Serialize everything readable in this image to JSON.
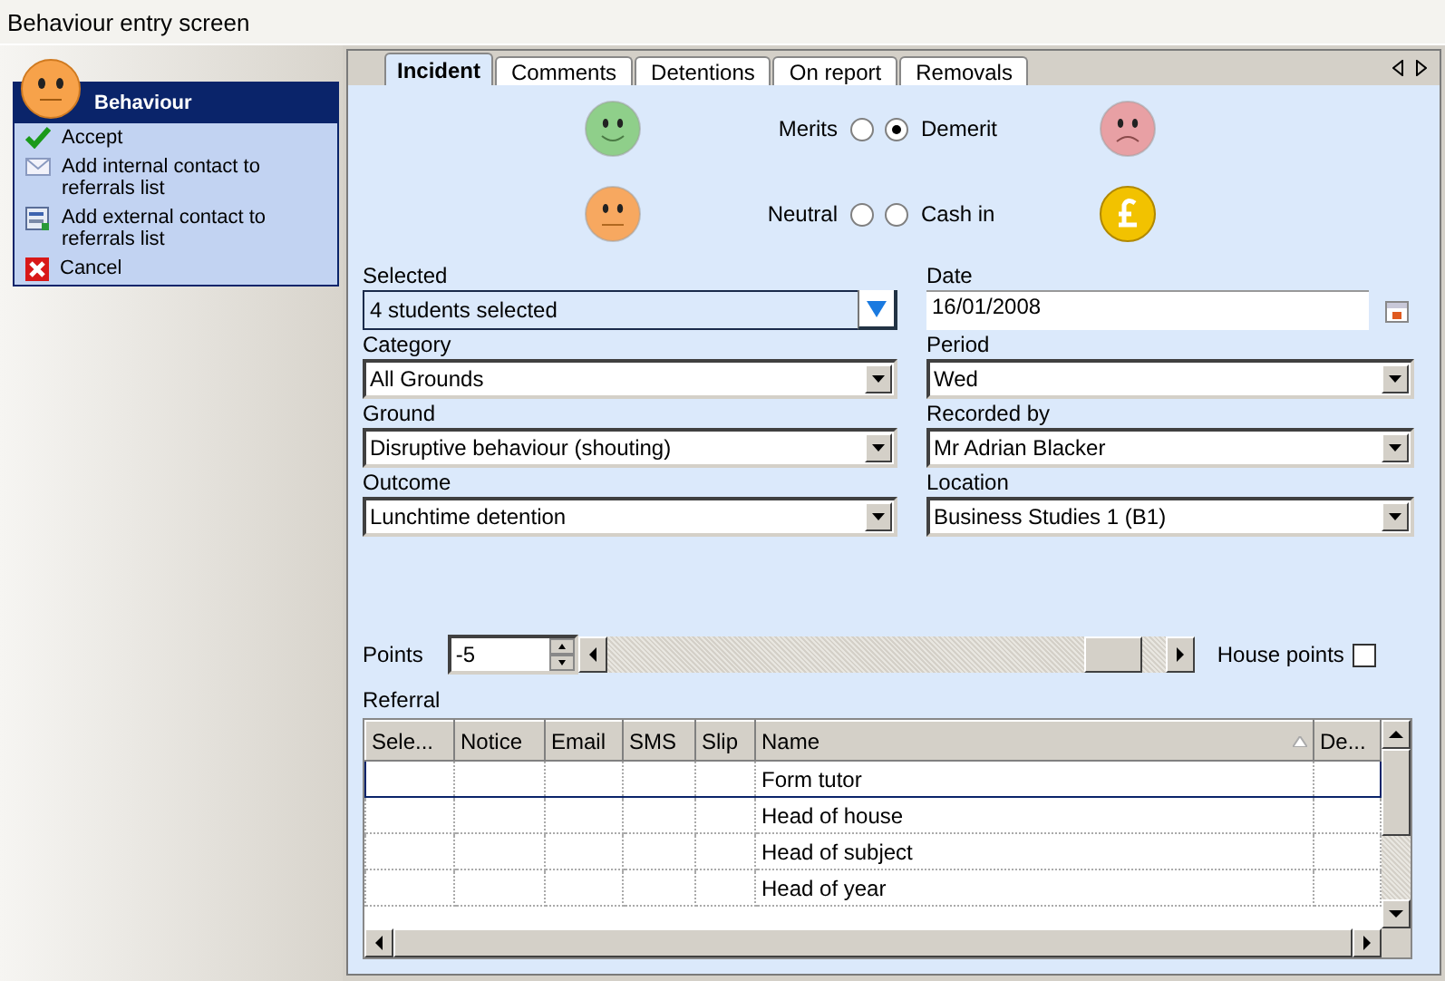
{
  "window": {
    "title": "Behaviour entry screen"
  },
  "taskbox": {
    "title": "Behaviour",
    "items": [
      {
        "kind": "accept",
        "label": "Accept"
      },
      {
        "kind": "internal",
        "label": "Add internal contact to referrals list"
      },
      {
        "kind": "external",
        "label": "Add external contact to referrals list"
      },
      {
        "kind": "cancel",
        "label": "Cancel"
      }
    ]
  },
  "tabs": [
    {
      "label": "Incident",
      "selected": true
    },
    {
      "label": "Comments",
      "selected": false
    },
    {
      "label": "Detentions",
      "selected": false
    },
    {
      "label": "On report",
      "selected": false
    },
    {
      "label": "Removals",
      "selected": false
    }
  ],
  "types": [
    {
      "kind": "happy",
      "label": "Merits",
      "selected": false
    },
    {
      "kind": "sad",
      "label": "Demerit",
      "selected": true
    },
    {
      "kind": "neutral",
      "label": "Neutral",
      "selected": false
    },
    {
      "kind": "pound",
      "label": "Cash in",
      "selected": false
    }
  ],
  "fields": {
    "selected": {
      "label": "Selected",
      "value": "4 students selected"
    },
    "date": {
      "label": "Date",
      "value": "16/01/2008"
    },
    "combos": [
      {
        "label": "Category",
        "value": "All Grounds"
      },
      {
        "label": "Period",
        "value": "Wed"
      },
      {
        "label": "Ground",
        "value": "Disruptive behaviour (shouting)"
      },
      {
        "label": "Recorded by",
        "value": "Mr Adrian Blacker"
      },
      {
        "label": "Outcome",
        "value": "Lunchtime detention"
      },
      {
        "label": "Location",
        "value": "Business Studies 1 (B1)"
      }
    ]
  },
  "points": {
    "label": "Points",
    "value": "-5",
    "level": 0.95
  },
  "house_points": {
    "label": "House points",
    "checked": false
  },
  "referral": {
    "label": "Referral",
    "columns": [
      "Sele...",
      "Notice",
      "Email",
      "SMS",
      "Slip",
      "Name",
      "De..."
    ],
    "rows": [
      {
        "name": "Form tutor",
        "focused": true
      },
      {
        "name": "Head of house",
        "focused": false
      },
      {
        "name": "Head of subject",
        "focused": false
      },
      {
        "name": "Head of year",
        "focused": false
      }
    ]
  }
}
